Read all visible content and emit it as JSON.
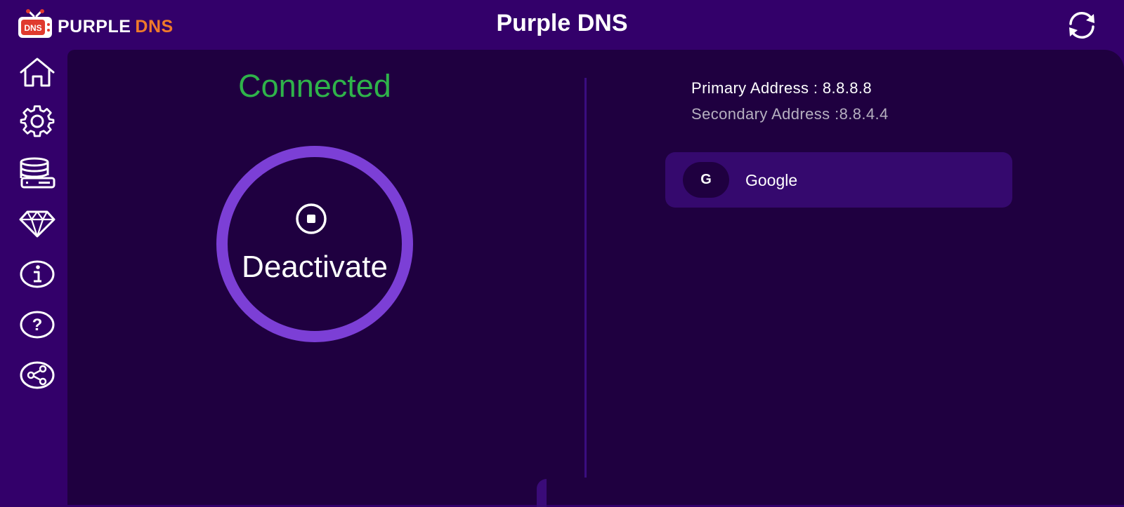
{
  "app": {
    "title": "Purple DNS",
    "logo": {
      "badge": "DNS",
      "word_left": "PURPLE",
      "word_right": "DNS"
    }
  },
  "header": {
    "refresh_icon": "refresh-icon"
  },
  "sidebar": {
    "items": [
      {
        "name": "home",
        "icon": "home-icon"
      },
      {
        "name": "settings",
        "icon": "gear-icon"
      },
      {
        "name": "servers",
        "icon": "database-icon"
      },
      {
        "name": "premium",
        "icon": "diamond-icon"
      },
      {
        "name": "info",
        "icon": "info-icon"
      },
      {
        "name": "help",
        "icon": "help-icon"
      },
      {
        "name": "share",
        "icon": "share-icon"
      }
    ]
  },
  "main": {
    "status": "Connected",
    "toggle_label": "Deactivate",
    "primary_address": "Primary Address : 8.8.8.8",
    "secondary_address": "Secondary Address :8.8.4.4",
    "provider": {
      "initial": "G",
      "name": "Google"
    }
  },
  "colors": {
    "background": "#33006a",
    "panel": "#1f0040",
    "accent": "#7c3fd6",
    "connected": "#2fb34a",
    "logo_orange": "#f07a2a",
    "logo_red": "#e03a2e"
  }
}
